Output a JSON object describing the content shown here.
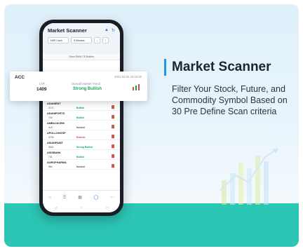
{
  "banner": {
    "title": "Market Scanner",
    "description": "Filter Your Stock, Future, and Commodity Symbol Based on 30 Pre Define Scan criteria",
    "accent_color": "#1a9be0",
    "band_color": "#2cc6b5"
  },
  "app": {
    "title": "Market Scanner",
    "filters": [
      "NSE Cash",
      "5 Minutes",
      "↓",
      "⋮"
    ],
    "scan_name": "Short EMA/ TE Bullish",
    "rows": [
      {
        "symbol": "ACC",
        "ltp": "1409",
        "trend": "Strong Bullish",
        "tone": "bull"
      },
      {
        "symbol": "ADANIENT",
        "ltp": "2171",
        "trend": "Bullish",
        "tone": "bull"
      },
      {
        "symbol": "ADANIPORTS",
        "ltp": "740",
        "trend": "Bullish",
        "tone": "bull"
      },
      {
        "symbol": "AMBUJACEM",
        "ltp": "415",
        "trend": "Neutral",
        "tone": "neu"
      },
      {
        "symbol": "APOLLOHOSP",
        "ltp": "4730",
        "trend": "Bearish",
        "tone": "bear"
      },
      {
        "symbol": "ASIANPAINT",
        "ltp": "3041",
        "trend": "Strong Bullish",
        "tone": "bull"
      },
      {
        "symbol": "AXISBANK",
        "ltp": "731",
        "trend": "Bullish",
        "tone": "bull"
      },
      {
        "symbol": "AUROPHARMA",
        "ltp": "584",
        "trend": "Neutral",
        "tone": "neu"
      }
    ],
    "highlight": {
      "symbol": "ACC",
      "time": "2021-03-25 15:04:00",
      "ltp_label": "LTP",
      "ltp": "1409",
      "trend_label": "Overall Market Trend",
      "trend": "Strong Bullish"
    },
    "nav_icons": [
      "home-icon",
      "watchlist-icon",
      "orders-icon",
      "scanner-icon",
      "more-icon"
    ]
  }
}
